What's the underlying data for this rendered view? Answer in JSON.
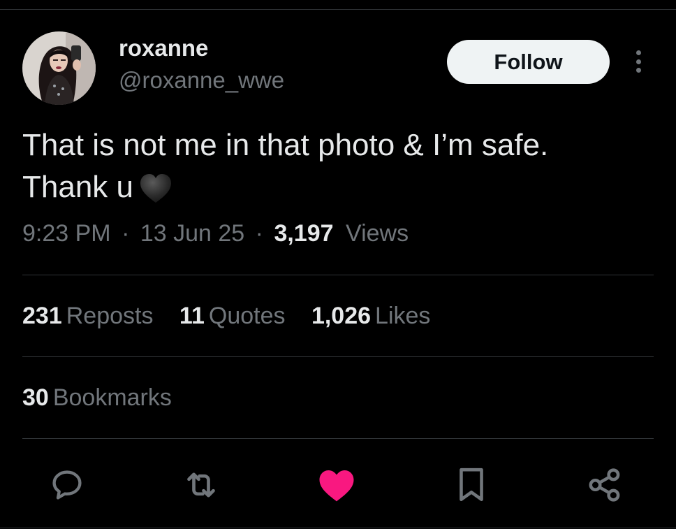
{
  "author": {
    "display_name": "roxanne",
    "handle": "@roxanne_wwe",
    "avatar_icon": "profile-photo"
  },
  "follow_button": {
    "label": "Follow"
  },
  "tweet": {
    "line1": "That is not me in that photo & I’m safe.",
    "line2": "Thank u",
    "emoji_icon": "black-heart-emoji"
  },
  "meta": {
    "time": "9:23 PM",
    "sep1": "·",
    "date": "13 Jun 25",
    "sep2": "·",
    "views_count": "3,197",
    "views_label": "Views"
  },
  "stats": {
    "reposts": {
      "count": "231",
      "label": "Reposts"
    },
    "quotes": {
      "count": "11",
      "label": "Quotes"
    },
    "likes": {
      "count": "1,026",
      "label": "Likes"
    }
  },
  "bookmarks": {
    "count": "30",
    "label": "Bookmarks"
  },
  "actions": [
    {
      "name": "reply",
      "icon": "reply-icon"
    },
    {
      "name": "repost",
      "icon": "repost-icon"
    },
    {
      "name": "like",
      "icon": "heart-icon",
      "active": true
    },
    {
      "name": "bookmark",
      "icon": "bookmark-icon"
    },
    {
      "name": "share",
      "icon": "share-icon"
    }
  ],
  "colors": {
    "background": "#000000",
    "text_primary": "#e7e9ea",
    "text_secondary": "#71767b",
    "divider": "#2f3336",
    "like_active": "#f91880",
    "follow_bg": "#eff3f4"
  }
}
